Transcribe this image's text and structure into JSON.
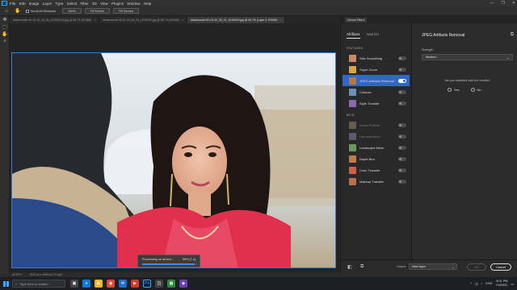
{
  "menubar": {
    "app_logo": "Ps",
    "items": [
      "File",
      "Edit",
      "Image",
      "Layer",
      "Type",
      "Select",
      "Filter",
      "3D",
      "View",
      "Plugins",
      "Window",
      "Help"
    ],
    "window_controls": [
      "minimize-icon",
      "restore-icon",
      "close-icon"
    ]
  },
  "options": {
    "scroll_all_windows": "Scroll All Windows",
    "zoom_value": "100%",
    "fit_screen": "Fit Screen",
    "fill_screen": "Fill Screen"
  },
  "tabs": [
    {
      "label": "Adaemonall HD-01.00_14_54_22.5000.00.jpg @ 66.7% (RGB/8)",
      "active": false
    },
    {
      "label": "Adaemonall HD-01.00_00_04_15.50000.jpg @ 66.7% (RGB/8)",
      "active": false
    },
    {
      "label": "Adaemonall HD-01.00_09_01_15.50000.jpg @ 66.7% (Layer 0, RGB/8)",
      "active": true
    }
  ],
  "statusbar": {
    "zoom": "66.67%",
    "doc_info": "1920 px x 1080 px (72 ppi)"
  },
  "processing": {
    "label": "Processing on device...",
    "percent_text": "96% (1 s)",
    "progress": 0.96
  },
  "neural_filters": {
    "panel_title": "Neural Filters",
    "tabs": [
      {
        "label": "All filters",
        "active": true
      },
      {
        "label": "Wait list",
        "active": false
      }
    ],
    "featured_heading": "FEATURED",
    "featured": [
      {
        "label": "Skin Smoothing",
        "on": false,
        "dim": false,
        "color": "#c98a6a"
      },
      {
        "label": "Super Zoom",
        "on": false,
        "dim": false,
        "color": "#d9a44b"
      },
      {
        "label": "JPEG Artifacts Removal",
        "on": true,
        "dim": false,
        "active": true,
        "color": "#b9773f"
      },
      {
        "label": "Colorize",
        "on": false,
        "dim": false,
        "color": "#6b8fb8"
      },
      {
        "label": "Style Transfer",
        "on": false,
        "dim": false,
        "color": "#8a6ab0"
      }
    ],
    "beta_heading": "BETA",
    "beta": [
      {
        "label": "Smart Portrait",
        "on": false,
        "dim": true,
        "color": "#6a5a4a"
      },
      {
        "label": "Harmonization",
        "on": false,
        "dim": true,
        "color": "#5a5a6a"
      },
      {
        "label": "Landscape Mixer",
        "on": false,
        "dim": false,
        "color": "#6a9a5a"
      },
      {
        "label": "Depth Blur",
        "on": false,
        "dim": false,
        "color": "#c27a4a"
      },
      {
        "label": "Color Transfer",
        "on": false,
        "dim": false,
        "color": "#d0604a"
      },
      {
        "label": "Makeup Transfer",
        "on": false,
        "dim": false,
        "color": "#b8704a"
      }
    ],
    "detail": {
      "title": "JPEG Artifacts Removal",
      "strength_label": "Strength",
      "strength_value": "Medium",
      "question": "Are you satisfied with the results?",
      "yes": "Yes",
      "no": "No"
    },
    "footer": {
      "output_label": "Output",
      "output_value": "New layer",
      "ok": "OK",
      "cancel": "Cancel"
    }
  },
  "taskbar": {
    "search_placeholder": "Type here to search",
    "tray_lang": "ENG",
    "time": "8:01 PM",
    "date": "7/4/2022"
  }
}
